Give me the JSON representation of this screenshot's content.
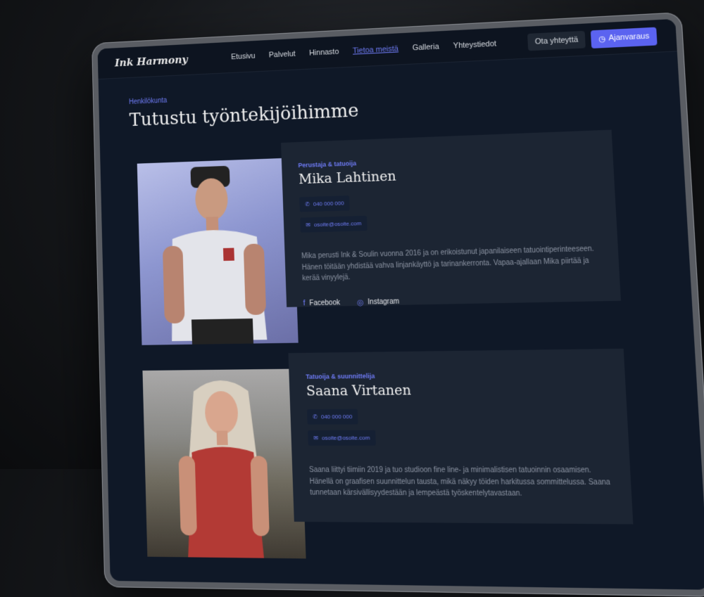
{
  "nav": {
    "logo": "Ink Harmony",
    "links": [
      "Etusivu",
      "Palvelut",
      "Hinnasto",
      "Tietoa meistä",
      "Galleria",
      "Yhteystiedot"
    ],
    "contact_btn": "Ota yhteyttä",
    "booking_btn": "Ajanvaraus"
  },
  "page": {
    "eyebrow": "Henkilökunta",
    "title": "Tutustu työntekijöihimme"
  },
  "staff": [
    {
      "role": "Perustaja & tatuoija",
      "name": "Mika Lahtinen",
      "phone": "040 000 000",
      "email": "osoite@osoite.com",
      "bio": "Mika perusti Ink & Soulin vuonna 2016 ja on erikoistunut japanilaiseen tatuointiperinteeseen. Hänen töitään yhdistää vahva linjankäyttö ja tarinankerronta. Vapaa-ajallaan Mika piirtää ja kerää vinyylejä.",
      "facebook": "Facebook",
      "instagram": "Instagram"
    },
    {
      "role": "Tatuoija & suunnittelija",
      "name": "Saana Virtanen",
      "phone": "040 000 000",
      "email": "osoite@osoite.com",
      "bio": "Saana liittyi tiimiin 2019 ja tuo studioon fine line- ja minimalistisen tatuoinnin osaamisen. Hänellä on graafisen suunnittelun tausta, mikä näkyy töiden harkitussa sommittelussa. Saana tunnetaan kärsivällisyydestään ja lempeästä työskentelytavastaan."
    }
  ],
  "icons": {
    "phone": "phone-icon",
    "email": "mail-icon",
    "facebook": "facebook-icon",
    "instagram": "instagram-icon",
    "calendar": "calendar-icon"
  },
  "colors": {
    "accent": "#6f7cf7",
    "bg": "#0f1827",
    "card": "#1c2533"
  }
}
